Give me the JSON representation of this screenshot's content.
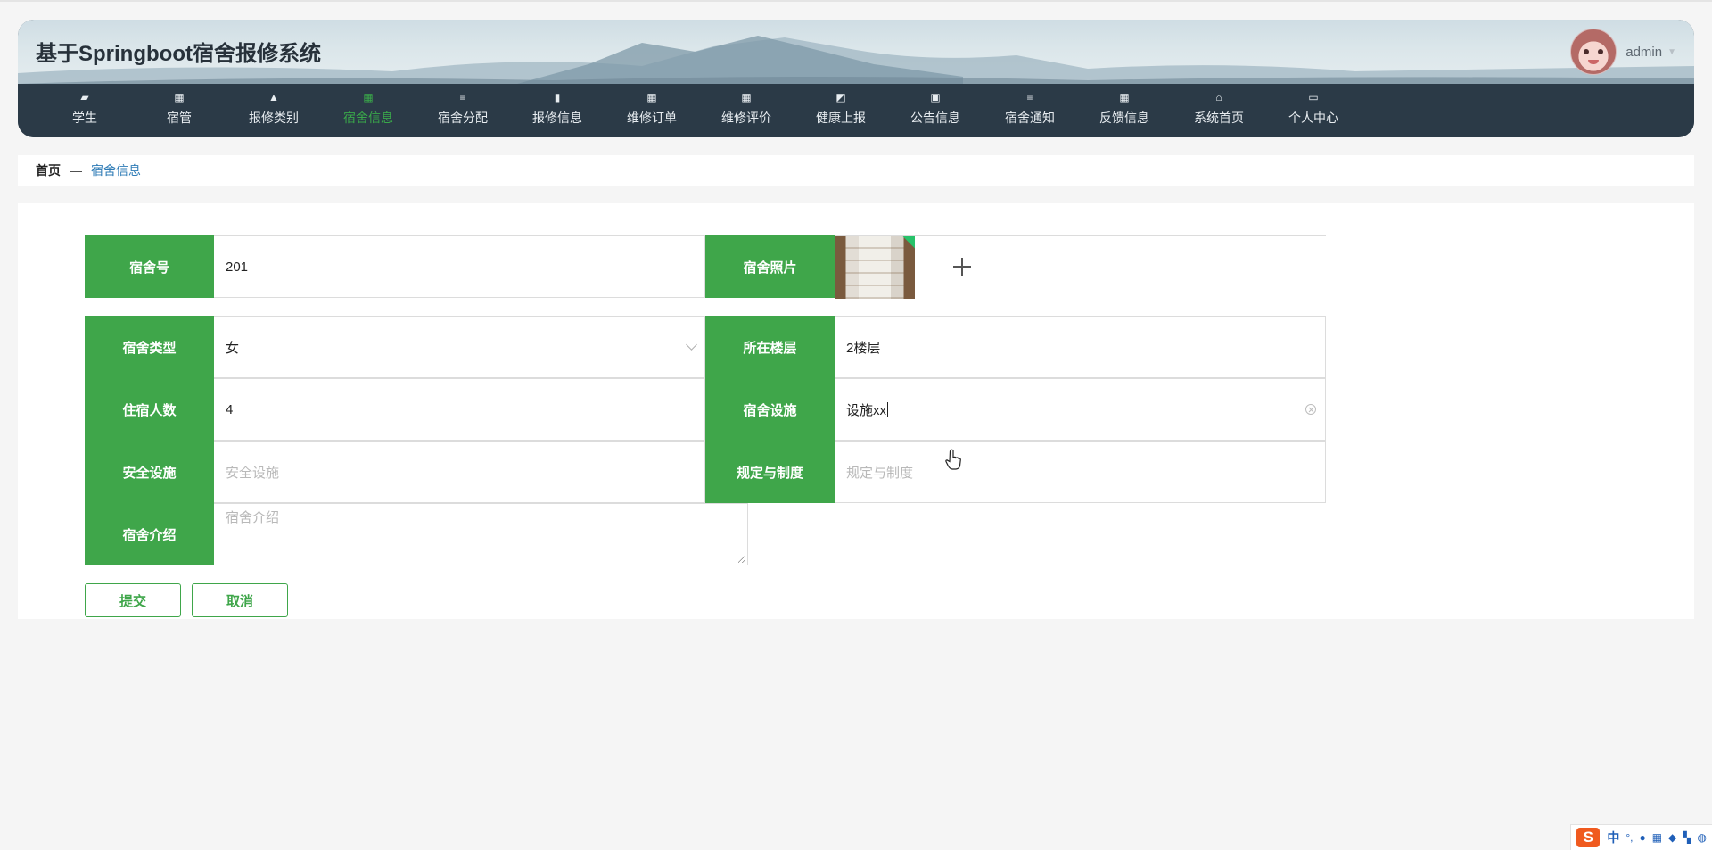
{
  "site_title": "基于Springboot宿舍报修系统",
  "user": {
    "name": "admin"
  },
  "nav": [
    {
      "label": "学生",
      "icon": "user-card-icon",
      "glyph": "▰"
    },
    {
      "label": "宿管",
      "icon": "grid-icon",
      "glyph": "▦"
    },
    {
      "label": "报修类别",
      "icon": "person-icon",
      "glyph": "▲"
    },
    {
      "label": "宿舍信息",
      "icon": "grid-icon",
      "glyph": "▦",
      "active": true
    },
    {
      "label": "宿舍分配",
      "icon": "list-icon",
      "glyph": "≡"
    },
    {
      "label": "报修信息",
      "icon": "bar-chart-icon",
      "glyph": "▮"
    },
    {
      "label": "维修订单",
      "icon": "grid-icon",
      "glyph": "▦"
    },
    {
      "label": "维修评价",
      "icon": "grid-icon",
      "glyph": "▦"
    },
    {
      "label": "健康上报",
      "icon": "line-chart-icon",
      "glyph": "◩"
    },
    {
      "label": "公告信息",
      "icon": "briefcase-icon",
      "glyph": "▣"
    },
    {
      "label": "宿舍通知",
      "icon": "list-icon",
      "glyph": "≡"
    },
    {
      "label": "反馈信息",
      "icon": "grid-icon",
      "glyph": "▦"
    },
    {
      "label": "系统首页",
      "icon": "home-icon",
      "glyph": "⌂"
    },
    {
      "label": "个人中心",
      "icon": "wallet-icon",
      "glyph": "▭"
    }
  ],
  "breadcrumb": {
    "home": "首页",
    "separator": "—",
    "current": "宿舍信息"
  },
  "form": {
    "dorm_no": {
      "label": "宿舍号",
      "value": "201"
    },
    "dorm_photo": {
      "label": "宿舍照片"
    },
    "dorm_type": {
      "label": "宿舍类型",
      "value": "女"
    },
    "floor": {
      "label": "所在楼层",
      "value": "2楼层"
    },
    "occupants": {
      "label": "住宿人数",
      "value": "4"
    },
    "facilities": {
      "label": "宿舍设施",
      "value": "设施xx"
    },
    "safety": {
      "label": "安全设施",
      "placeholder": "安全设施"
    },
    "rules": {
      "label": "规定与制度",
      "placeholder": "规定与制度"
    },
    "intro": {
      "label": "宿舍介绍",
      "placeholder": "宿舍介绍"
    }
  },
  "buttons": {
    "submit": "提交",
    "cancel": "取消"
  },
  "ime": {
    "logo": "S",
    "lang": "中"
  }
}
